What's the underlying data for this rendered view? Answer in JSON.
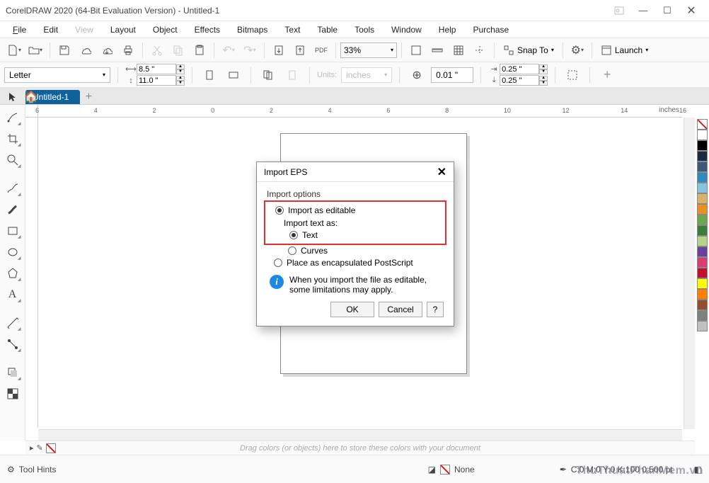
{
  "window": {
    "title": "CorelDRAW 2020 (64-Bit Evaluation Version) - Untitled-1"
  },
  "menu": {
    "file": "File",
    "edit": "Edit",
    "view": "View",
    "layout": "Layout",
    "object": "Object",
    "effects": "Effects",
    "bitmaps": "Bitmaps",
    "text": "Text",
    "table": "Table",
    "tools": "Tools",
    "window": "Window",
    "help": "Help",
    "purchase": "Purchase"
  },
  "toolbar": {
    "zoom": "33%",
    "snap": "Snap To",
    "launch": "Launch"
  },
  "propbar": {
    "pagesize": "Letter",
    "width": "8.5 \"",
    "height": "11.0 \"",
    "units_label": "Units:",
    "units_value": "inches",
    "nudge": "0.01 \"",
    "dup_x": "0.25 \"",
    "dup_y": "0.25 \""
  },
  "tabs": {
    "doc": "Untitled-1"
  },
  "ruler": {
    "unit": "inches",
    "ticks": [
      "6",
      "4",
      "2",
      "0",
      "2",
      "4",
      "6",
      "8",
      "10",
      "12",
      "14",
      "16"
    ]
  },
  "colorstrip": {
    "hint": "Drag colors (or objects) here to store these colors with your document"
  },
  "status": {
    "hints": "Tool Hints",
    "fill_none": "None",
    "cmyk": "C:0 M:0 Y:0 K:100 0.500 pt"
  },
  "dialog": {
    "title": "Import EPS",
    "group": "Import options",
    "opt_editable": "Import as editable",
    "text_as": "Import text as:",
    "opt_text": "Text",
    "opt_curves": "Curves",
    "opt_encaps": "Place as encapsulated PostScript",
    "info": "When you import the file as editable, some limitations may apply.",
    "ok": "OK",
    "cancel": "Cancel",
    "help": "?"
  },
  "palette": [
    "#ffffff",
    "#000000",
    "#1a2c3f",
    "#3a5a7a",
    "#2e8bc0",
    "#86c5e0",
    "#d9b36a",
    "#e89020",
    "#6aa84f",
    "#3a7d3a",
    "#b5d48b",
    "#6b3fa0",
    "#d94070",
    "#c01030",
    "#ffff00",
    "#ff8000",
    "#905030",
    "#808080",
    "#c0c0c0"
  ],
  "watermark": "ThuThuatPhanMem.vn"
}
